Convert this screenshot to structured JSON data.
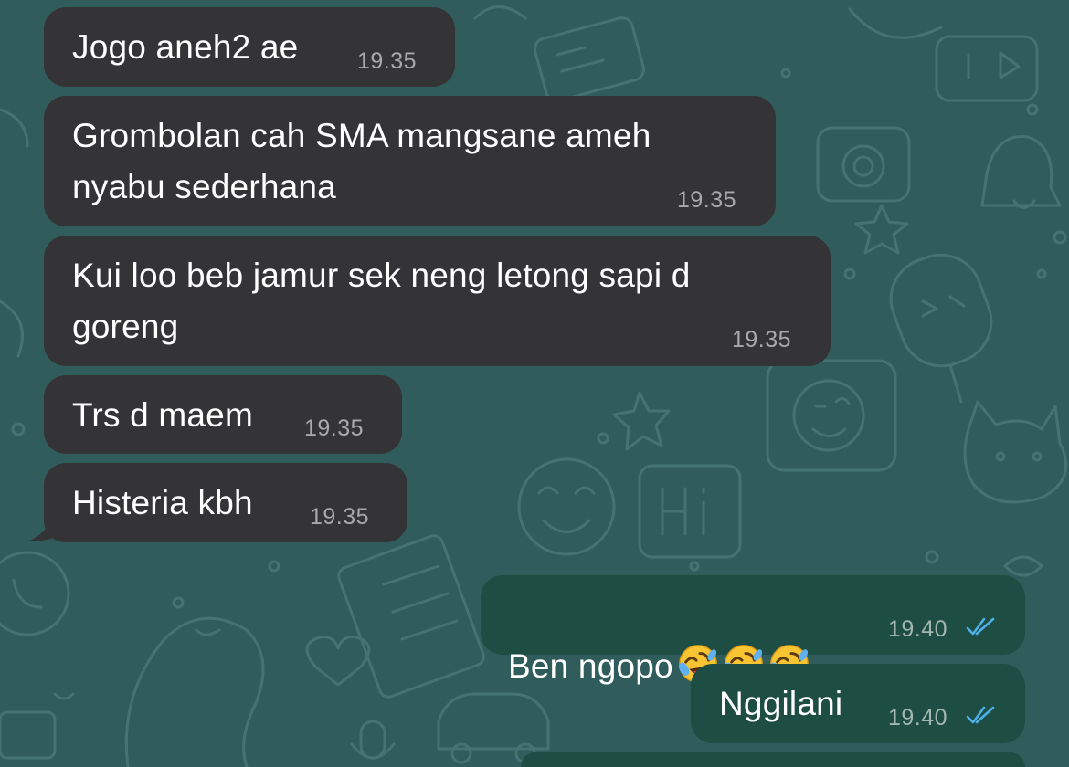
{
  "chat": {
    "theme": {
      "background": "#305d5b",
      "incoming_bubble": "#343436",
      "outgoing_bubble": "#1e4d43",
      "read_tick_color": "#4fb0e8"
    },
    "messages": [
      {
        "direction": "incoming",
        "text": "Jogo aneh2 ae",
        "time": "19.35"
      },
      {
        "direction": "incoming",
        "text": "Grombolan cah SMA mangsane ameh\nnyabu sederhana",
        "time": "19.35"
      },
      {
        "direction": "incoming",
        "text": "Kui loo beb jamur sek neng letong sapi d\ngoreng",
        "time": "19.35"
      },
      {
        "direction": "incoming",
        "text": "Trs d maem",
        "time": "19.35"
      },
      {
        "direction": "incoming",
        "text": "Histeria kbh",
        "time": "19.35"
      },
      {
        "direction": "outgoing",
        "text": "Ben ngopo",
        "emoji": [
          "rolling-on-floor-laughing",
          "rolling-on-floor-laughing",
          "rolling-on-floor-laughing"
        ],
        "time": "19.40",
        "status": "read"
      },
      {
        "direction": "outgoing",
        "text": "Nggilani",
        "time": "19.40",
        "status": "read"
      }
    ]
  }
}
